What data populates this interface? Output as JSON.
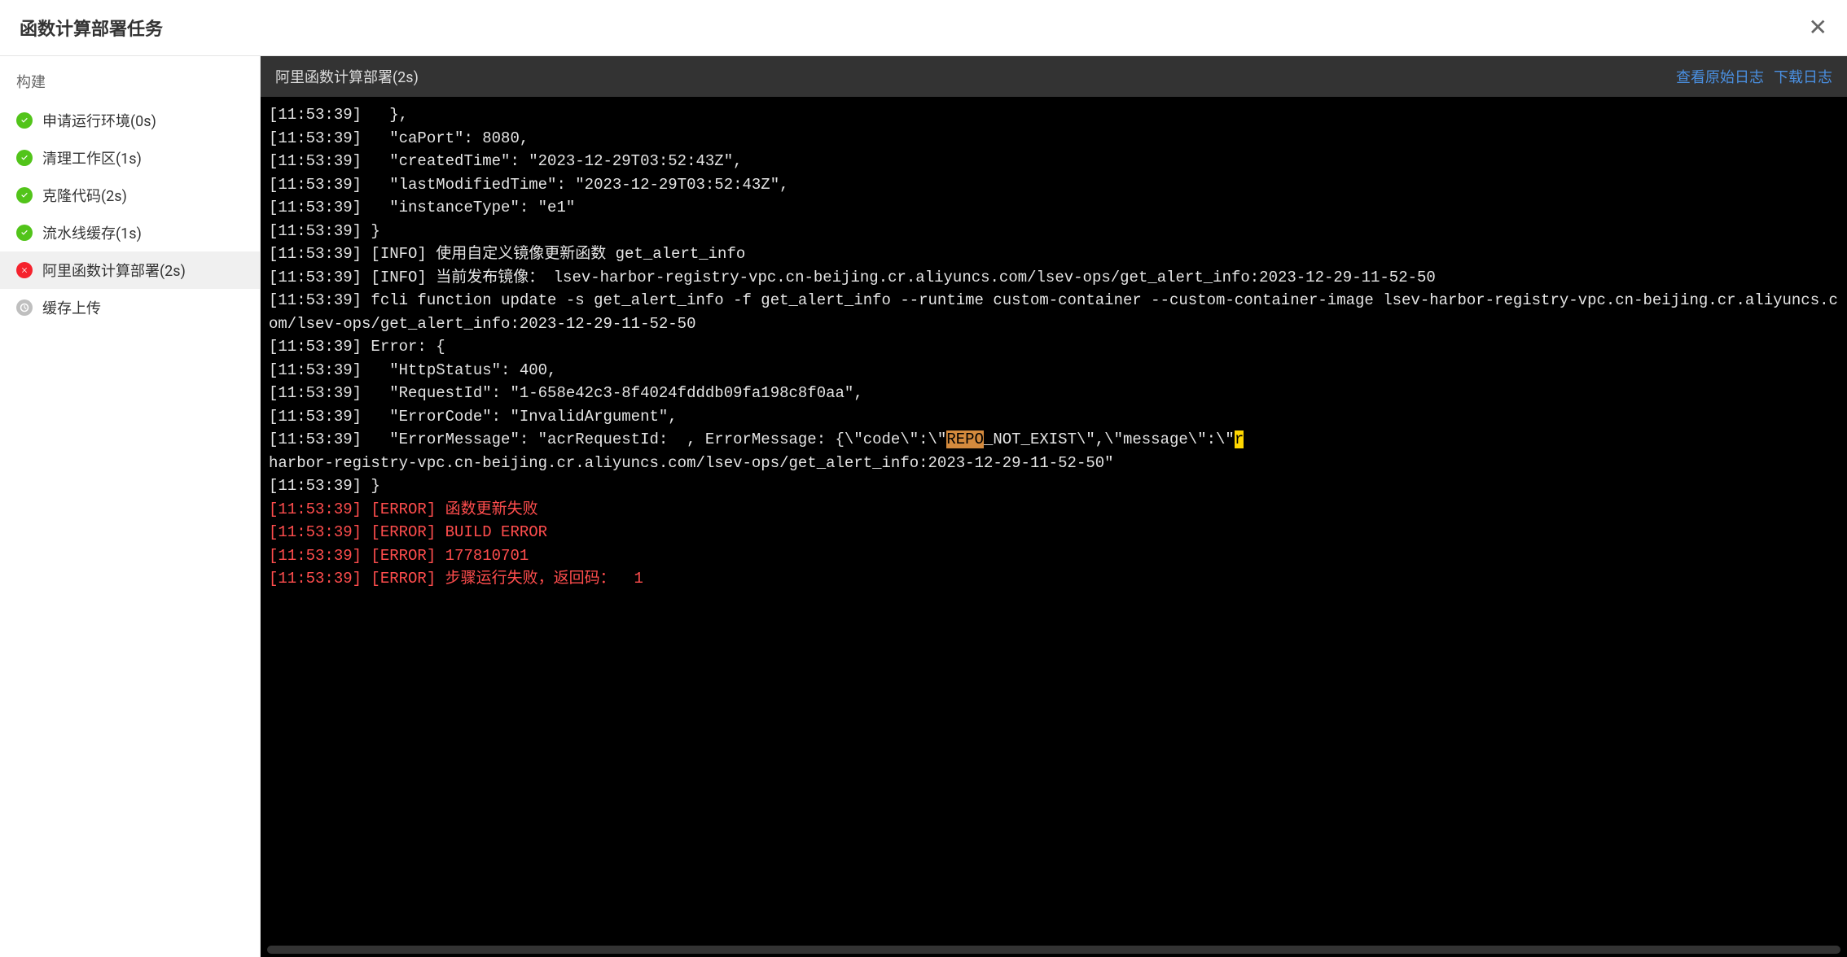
{
  "header": {
    "title": "函数计算部署任务"
  },
  "sidebar": {
    "section_title": "构建",
    "steps": [
      {
        "label": "申请运行环境(0s)",
        "status": "success"
      },
      {
        "label": "清理工作区(1s)",
        "status": "success"
      },
      {
        "label": "克隆代码(2s)",
        "status": "success"
      },
      {
        "label": "流水线缓存(1s)",
        "status": "success"
      },
      {
        "label": "阿里函数计算部署(2s)",
        "status": "error"
      },
      {
        "label": "缓存上传",
        "status": "pending"
      }
    ]
  },
  "content": {
    "title": "阿里函数计算部署(2s)",
    "actions": {
      "view_raw": "查看原始日志",
      "download": "下载日志"
    }
  },
  "logs": [
    {
      "text": "[11:53:39]   },",
      "type": "normal"
    },
    {
      "text": "[11:53:39]   \"caPort\": 8080,",
      "type": "normal"
    },
    {
      "text": "[11:53:39]   \"createdTime\": \"2023-12-29T03:52:43Z\",",
      "type": "normal"
    },
    {
      "text": "[11:53:39]   \"lastModifiedTime\": \"2023-12-29T03:52:43Z\",",
      "type": "normal"
    },
    {
      "text": "[11:53:39]   \"instanceType\": \"e1\"",
      "type": "normal"
    },
    {
      "text": "[11:53:39] }",
      "type": "normal"
    },
    {
      "text": "[11:53:39] [INFO] 使用自定义镜像更新函数 get_alert_info",
      "type": "normal"
    },
    {
      "text": "[11:53:39] [INFO] 当前发布镜像： lsev-harbor-registry-vpc.cn-beijing.cr.aliyuncs.com/lsev-ops/get_alert_info:2023-12-29-11-52-50",
      "type": "normal"
    },
    {
      "text": "[11:53:39] fcli function update -s get_alert_info -f get_alert_info --runtime custom-container --custom-container-image lsev-harbor-registry-vpc.cn-beijing.cr.aliyuncs.com/lsev-ops/get_alert_info:2023-12-29-11-52-50",
      "type": "normal"
    },
    {
      "text": "[11:53:39] Error: {",
      "type": "normal"
    },
    {
      "text": "[11:53:39]   \"HttpStatus\": 400,",
      "type": "normal"
    },
    {
      "text": "[11:53:39]   \"RequestId\": \"1-658e42c3-8f4024fdddb09fa198c8f0aa\",",
      "type": "normal"
    },
    {
      "text": "[11:53:39]   \"ErrorCode\": \"InvalidArgument\",",
      "type": "normal"
    },
    {
      "text": "[11:53:39]   \"ErrorMessage\": \"acrRequestId:  , ErrorMessage: {\\\"code\\\":\\\"",
      "type": "normal-with-highlights",
      "suffix_orange": "REPO",
      "suffix_normal": "_NOT_EXIST\\\",\\\"message\\\":\\\"",
      "suffix_yellow": "r"
    },
    {
      "text": "harbor-registry-vpc.cn-beijing.cr.aliyuncs.com/lsev-ops/get_alert_info:2023-12-29-11-52-50\"",
      "type": "normal"
    },
    {
      "text": "[11:53:39] }",
      "type": "normal"
    },
    {
      "text": "[11:53:39] [ERROR] 函数更新失败",
      "type": "error"
    },
    {
      "text": "[11:53:39] [ERROR] BUILD ERROR",
      "type": "error"
    },
    {
      "text": "[11:53:39] [ERROR] 177810701",
      "type": "error"
    },
    {
      "text": "[11:53:39] [ERROR] 步骤运行失败，返回码：  1",
      "type": "error"
    }
  ]
}
